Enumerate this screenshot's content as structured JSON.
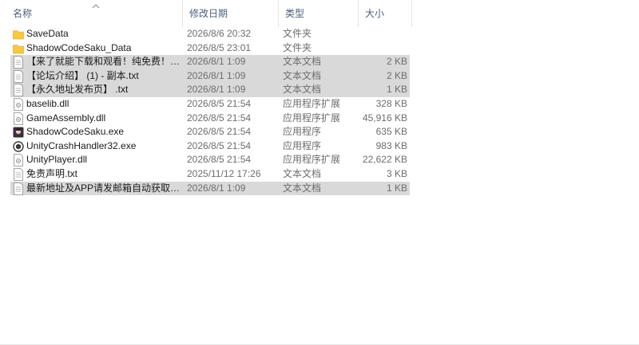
{
  "columns": {
    "name": "名称",
    "date": "修改日期",
    "type": "类型",
    "size": "大小"
  },
  "colors": {
    "folder": "#f8c843",
    "selected_row": "#d9d9d9",
    "header_text": "#4c607a"
  },
  "files": [
    {
      "name": "SaveData",
      "date": "2026/8/6 20:32",
      "type": "文件夹",
      "size": "",
      "icon": "folder-icon",
      "selected": false
    },
    {
      "name": "ShadowCodeSaku_Data",
      "date": "2026/8/5 23:01",
      "type": "文件夹",
      "size": "",
      "icon": "folder-icon",
      "selected": false
    },
    {
      "name": "【来了就能下载和观看！纯免费！】 - 副...",
      "date": "2026/8/1 1:09",
      "type": "文本文档",
      "size": "2 KB",
      "icon": "text-file-icon",
      "selected": true
    },
    {
      "name": "【论坛介绍】 (1) - 副本.txt",
      "date": "2026/8/1 1:09",
      "type": "文本文档",
      "size": "2 KB",
      "icon": "text-file-icon",
      "selected": true
    },
    {
      "name": "【永久地址发布页】 .txt",
      "date": "2026/8/1 1:09",
      "type": "文本文档",
      "size": "1 KB",
      "icon": "text-file-icon",
      "selected": true
    },
    {
      "name": "baselib.dll",
      "date": "2026/8/5 21:54",
      "type": "应用程序扩展",
      "size": "328 KB",
      "icon": "dll-file-icon",
      "selected": false
    },
    {
      "name": "GameAssembly.dll",
      "date": "2026/8/5 21:54",
      "type": "应用程序扩展",
      "size": "45,916 KB",
      "icon": "dll-file-icon",
      "selected": false
    },
    {
      "name": "ShadowCodeSaku.exe",
      "date": "2026/8/5 21:54",
      "type": "应用程序",
      "size": "635 KB",
      "icon": "game-exe-icon",
      "selected": false
    },
    {
      "name": "UnityCrashHandler32.exe",
      "date": "2026/8/5 21:54",
      "type": "应用程序",
      "size": "983 KB",
      "icon": "unity-exe-icon",
      "selected": false
    },
    {
      "name": "UnityPlayer.dll",
      "date": "2026/8/5 21:54",
      "type": "应用程序扩展",
      "size": "22,622 KB",
      "icon": "dll-file-icon",
      "selected": false
    },
    {
      "name": "免责声明.txt",
      "date": "2025/11/12 17:26",
      "type": "文本文档",
      "size": "3 KB",
      "icon": "text-file-icon",
      "selected": false
    },
    {
      "name": "最新地址及APP请发邮箱自动获取！！！...",
      "date": "2026/8/1 1:09",
      "type": "文本文档",
      "size": "1 KB",
      "icon": "text-file-icon",
      "selected": true
    }
  ]
}
